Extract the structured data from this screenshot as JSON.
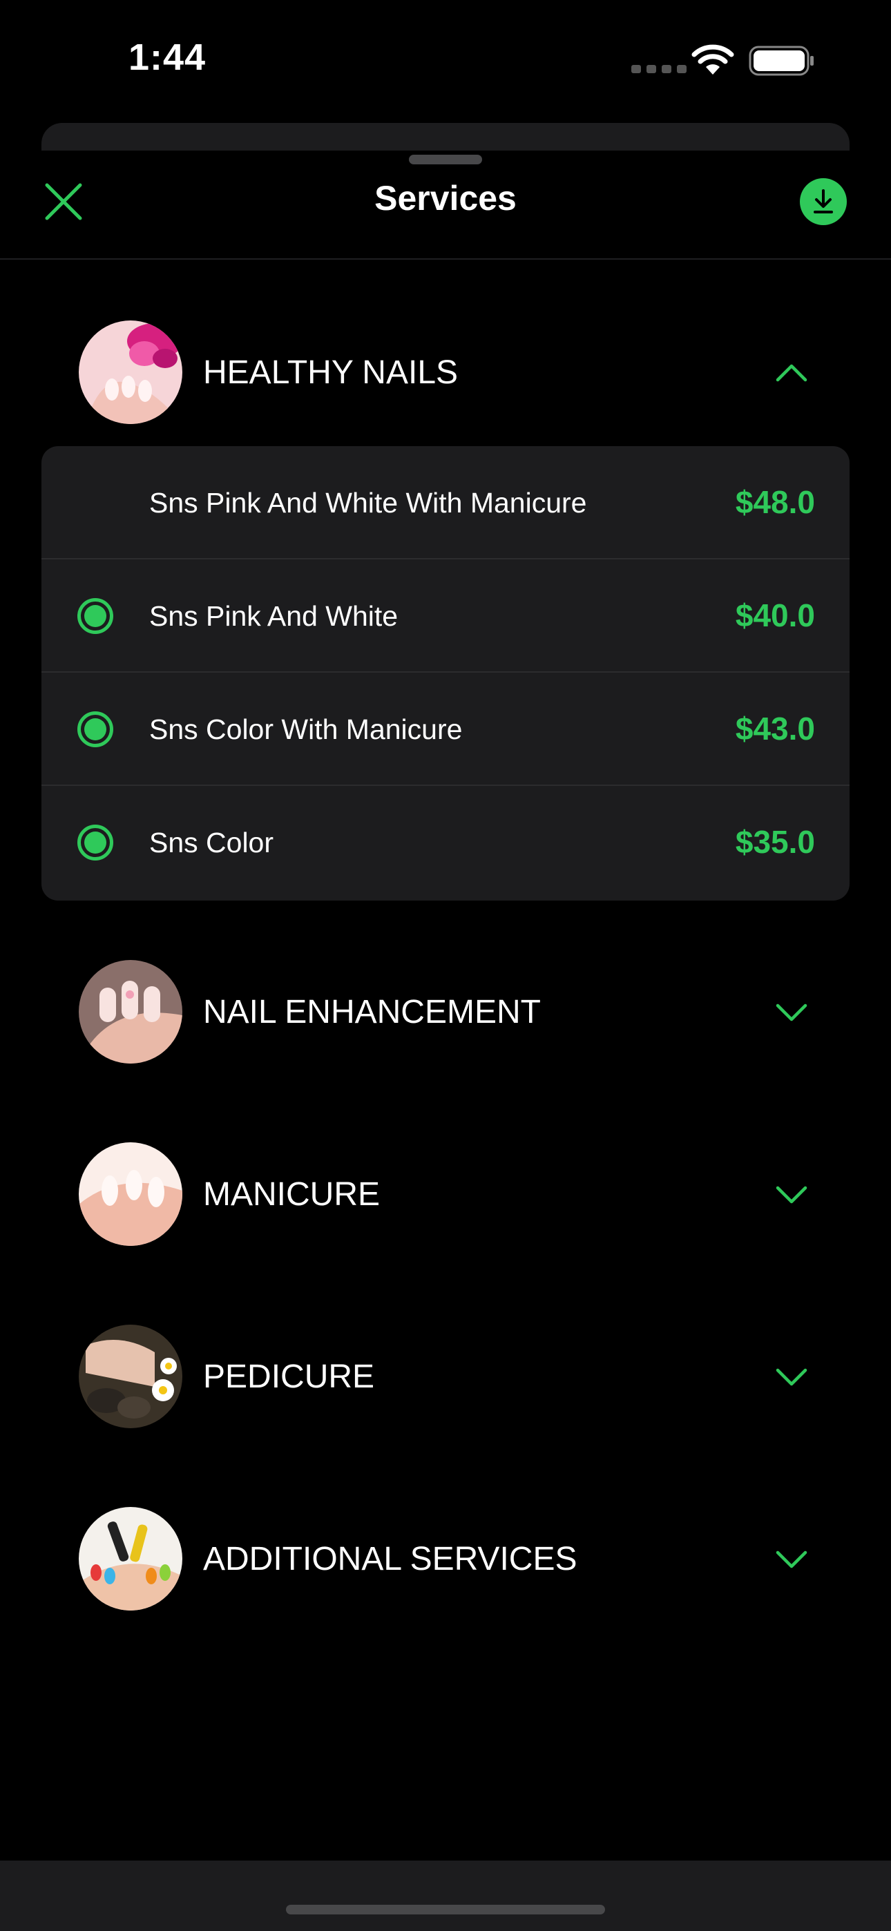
{
  "status_bar": {
    "time": "1:44"
  },
  "nav": {
    "title": "Services",
    "close_icon": "close-x-icon",
    "download_icon": "download-icon"
  },
  "colors": {
    "accent": "#2fc95a",
    "card": "#1c1c1e",
    "background": "#000000"
  },
  "categories": [
    {
      "title": "HEALTHY NAILS",
      "expanded": true,
      "chevron": "chevron-up-icon",
      "services": [
        {
          "name": "Sns Pink And White With Manicure",
          "price": "$48.0",
          "selected": false
        },
        {
          "name": "Sns Pink And White",
          "price": "$40.0",
          "selected": true
        },
        {
          "name": "Sns Color With Manicure",
          "price": "$43.0",
          "selected": true
        },
        {
          "name": "Sns Color",
          "price": "$35.0",
          "selected": true
        }
      ]
    },
    {
      "title": "NAIL ENHANCEMENT",
      "expanded": false,
      "chevron": "chevron-down-icon"
    },
    {
      "title": "MANICURE",
      "expanded": false,
      "chevron": "chevron-down-icon"
    },
    {
      "title": "PEDICURE",
      "expanded": false,
      "chevron": "chevron-down-icon"
    },
    {
      "title": "ADDITIONAL SERVICES",
      "expanded": false,
      "chevron": "chevron-down-icon"
    }
  ]
}
